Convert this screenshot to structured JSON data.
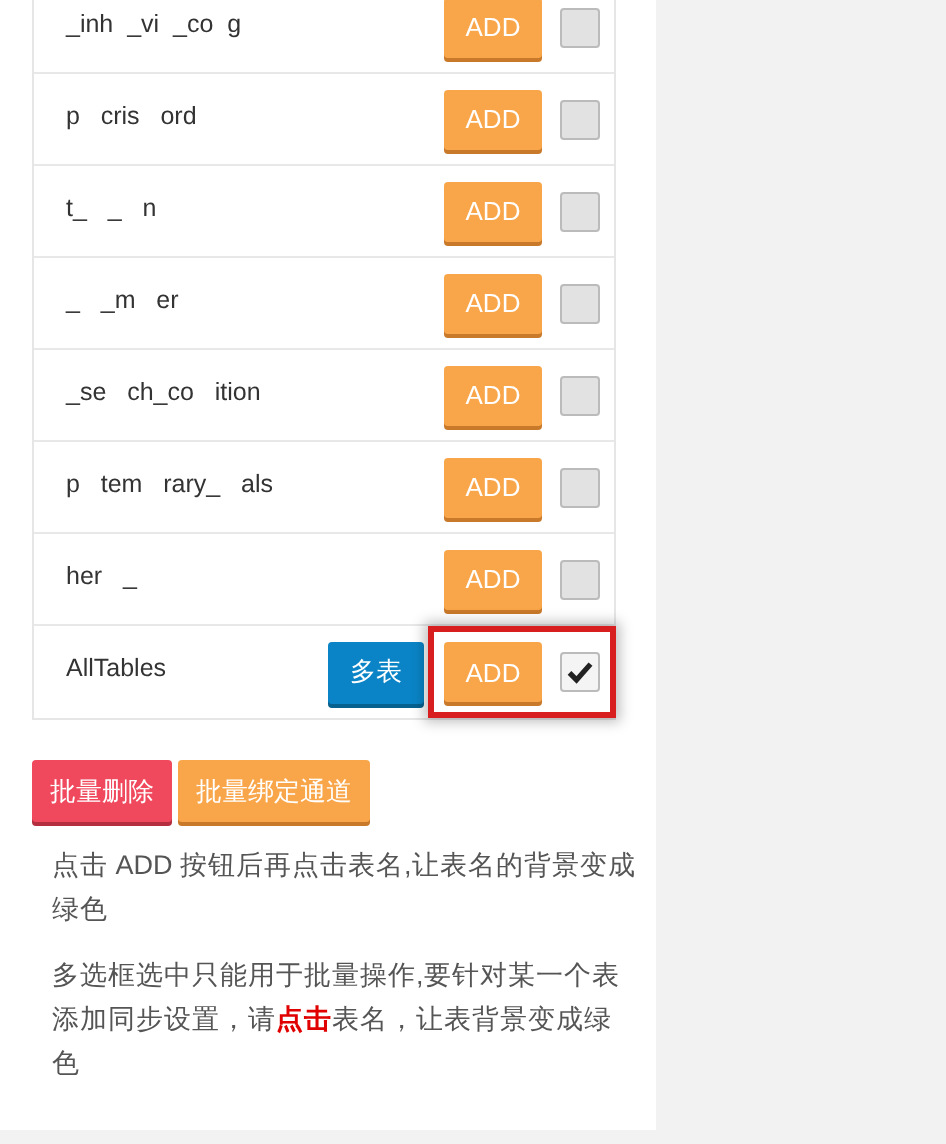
{
  "tables": [
    {
      "name": "_inh  _vi  _co  g",
      "add_label": "ADD",
      "checked": false,
      "highlighted": false
    },
    {
      "name": "p   cris   ord",
      "add_label": "ADD",
      "checked": false,
      "highlighted": false
    },
    {
      "name": "t_   _   n",
      "add_label": "ADD",
      "checked": false,
      "highlighted": false
    },
    {
      "name": "_   _m   er",
      "add_label": "ADD",
      "checked": false,
      "highlighted": false
    },
    {
      "name": "_se   ch_co   ition",
      "add_label": "ADD",
      "checked": false,
      "highlighted": false
    },
    {
      "name": "p   tem   rary_   als",
      "add_label": "ADD",
      "checked": false,
      "highlighted": false
    },
    {
      "name": "her   _",
      "add_label": "ADD",
      "checked": false,
      "highlighted": false
    },
    {
      "name": "AllTables",
      "add_label": "ADD",
      "checked": true,
      "highlighted": true,
      "multi_button": "多表"
    }
  ],
  "actions": [
    {
      "label": "批量删除",
      "kind": "danger"
    },
    {
      "label": "批量绑定通道",
      "kind": "warning"
    }
  ],
  "notes": [
    "点击 ADD 按钮后再点击表名,让表名的背景变成绿色",
    "多选框选中只能用于批量操作,要针对某一个表添加同步设置，请**点击**表名，让表背景变成绿色"
  ]
}
